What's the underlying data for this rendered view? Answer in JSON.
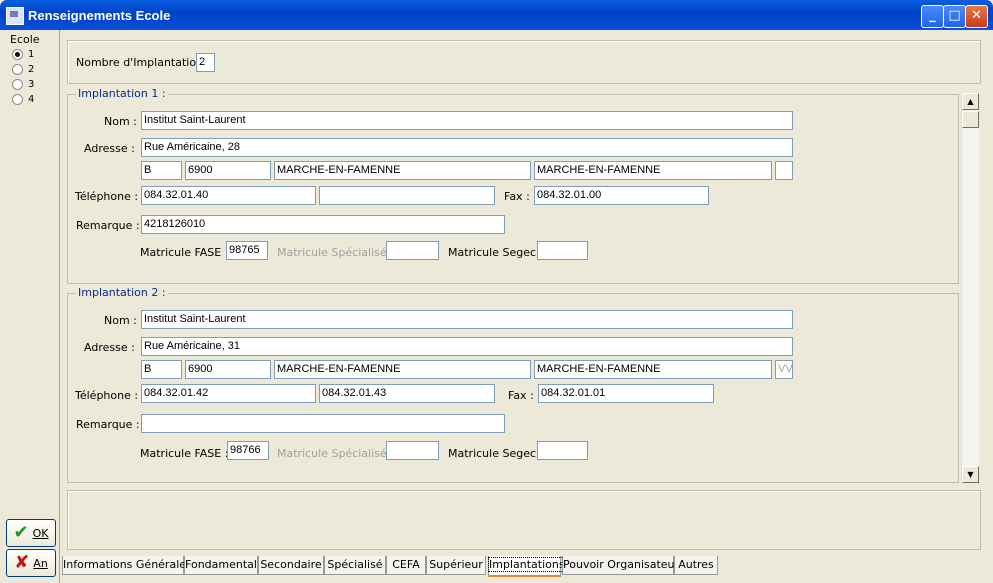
{
  "window": {
    "title": "Renseignements Ecole"
  },
  "ecole": {
    "label": "Ecole",
    "options": [
      "1",
      "2",
      "3",
      "4"
    ],
    "selected": "1"
  },
  "buttons": {
    "ok_label": "OK",
    "an_label": "An"
  },
  "header": {
    "nb_label": "Nombre d'Implantations :",
    "nb_value": "2"
  },
  "labels": {
    "nom": "Nom :",
    "adresse": "Adresse :",
    "telephone": "Téléphone :",
    "fax": "Fax :",
    "remarque": "Remarque :",
    "matricule_fase": "Matricule FASE :",
    "matricule_specialise": "Matricule Spécialisé :",
    "matricule_segec": "Matricule Segec :"
  },
  "implantations": [
    {
      "title": "Implantation 1 :",
      "nom": "Institut Saint-Laurent",
      "adresse": "Rue Américaine, 28",
      "pays": "B",
      "cp": "6900",
      "localite": "MARCHE-EN-FAMENNE",
      "commune": "MARCHE-EN-FAMENNE",
      "extra": "",
      "tel1": "084.32.01.40",
      "tel2": "",
      "fax": "084.32.01.00",
      "remarque": "4218126010",
      "fase": "98765",
      "specialise": "",
      "segec": ""
    },
    {
      "title": "Implantation 2 :",
      "nom": "Institut Saint-Laurent",
      "adresse": "Rue Américaine, 31",
      "pays": "B",
      "cp": "6900",
      "localite": "MARCHE-EN-FAMENNE",
      "commune": "MARCHE-EN-FAMENNE",
      "extra": "VV",
      "tel1": "084.32.01.42",
      "tel2": "084.32.01.43",
      "fax": "084.32.01.01",
      "remarque": "",
      "fase": "98766",
      "specialise": "",
      "segec": ""
    }
  ],
  "tabs": [
    "Informations Générales",
    "Fondamental",
    "Secondaire",
    "Spécialisé",
    "CEFA",
    "Supérieur",
    "Implantations",
    "Pouvoir Organisateur",
    "Autres"
  ],
  "active_tab": "Implantations"
}
